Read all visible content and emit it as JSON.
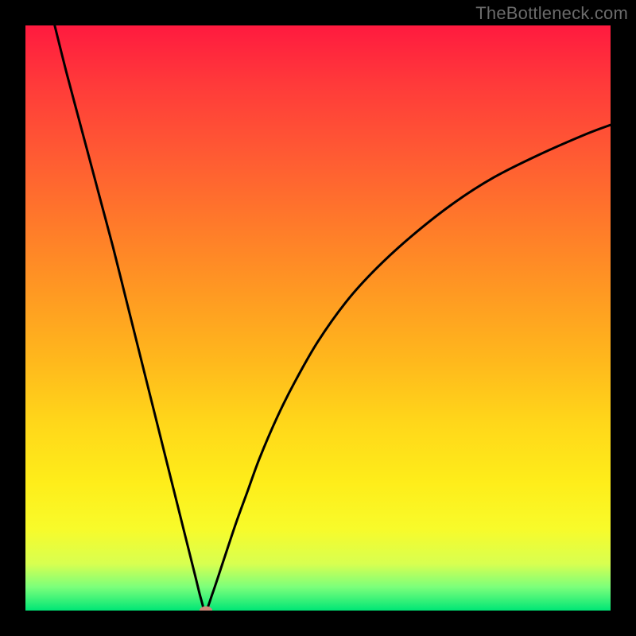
{
  "watermark": "TheBottleneck.com",
  "colors": {
    "frame_bg": "#000000",
    "curve_stroke": "#000000",
    "marker_fill": "#cf8a7a",
    "watermark_text": "#6b6b6b"
  },
  "chart_data": {
    "type": "line",
    "title": "",
    "xlabel": "",
    "ylabel": "",
    "xlim": [
      0,
      100
    ],
    "ylim": [
      0,
      100
    ],
    "marker": {
      "x": 30.8,
      "y": 0
    },
    "series": [
      {
        "name": "bottleneck-curve",
        "x": [
          5,
          7,
          9,
          11,
          13,
          15,
          17,
          19,
          21,
          23,
          25,
          27,
          29,
          30,
          30.8,
          32,
          34,
          36,
          38,
          40,
          43,
          46,
          50,
          55,
          60,
          66,
          73,
          80,
          88,
          96,
          100
        ],
        "y": [
          100,
          92,
          84.5,
          77,
          69.5,
          62,
          54,
          46,
          38,
          30,
          22,
          14,
          6,
          2,
          0,
          3,
          9,
          15,
          20.5,
          26,
          33,
          39,
          46,
          53,
          58.5,
          64,
          69.5,
          74,
          78,
          81.5,
          83
        ]
      }
    ]
  }
}
